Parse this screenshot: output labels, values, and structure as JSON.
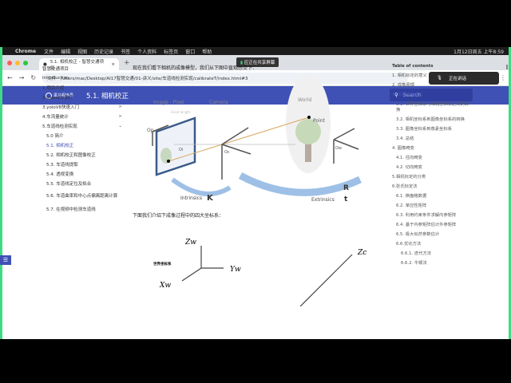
{
  "menubar": {
    "apple": "",
    "app": "Chrome",
    "items": [
      "文件",
      "编辑",
      "视图",
      "历史记录",
      "书签",
      "个人资料",
      "标签页",
      "窗口",
      "帮助"
    ],
    "clock": "1月12日周五 上午8:59"
  },
  "tab": {
    "title": "5.1. 相机校正 - 智慧交通项目",
    "close": "×",
    "new": "+"
  },
  "sharing": "应正在共享屏幕",
  "address": {
    "scheme": "文件",
    "url": "/Users/mac/Desktop/AI17智慧交通/01-讲义/site/车道线检测实现/calibrateT/index.html#3"
  },
  "mic_popup": "正在讲话",
  "header": {
    "logo": "黑马程序员",
    "title": "5.1. 相机校正",
    "search_placeholder": "Search"
  },
  "nav": [
    {
      "label": "智慧交通项目"
    },
    {
      "label": "Introduction"
    },
    {
      "label": "1.项目介绍"
    },
    {
      "label": "2.OpenCV简介",
      "chev": ">"
    },
    {
      "label": "3.yoloV8快速入门",
      "chev": ">"
    },
    {
      "label": "4.车流量统计",
      "chev": ">"
    },
    {
      "label": "5.车道线检测实现",
      "chev": "⌄"
    }
  ],
  "subnav": [
    "5.0 简介",
    "5.1. 相机校正",
    "5.2. 相机校正和图像校正",
    "5.3. 车道线提取",
    "5.4. 透视变换",
    "5.5. 车道线定位及拟合",
    "5.6. 车道曲率和中心点偏离距离计算",
    "5.7. 在视频中检测车道线"
  ],
  "main": {
    "p1": "现在我们看下相机的成像模型，我们从下图中直观感受下：",
    "p2": "下面我们介绍下成像过程中的四大坐标系：",
    "fig1": {
      "image_pixel": "Image - Pixel",
      "camera": "Camera",
      "world": "World",
      "focal": "Focal length",
      "point": "Point",
      "op": "Op",
      "oi": "Oi",
      "oc": "Oc",
      "ow": "Ow",
      "intrinsics": "Intrinsics",
      "K": "K",
      "extrinsics": "Extrinsics",
      "R": "R",
      "t": "t"
    },
    "fig2": {
      "world_cs": "世界坐标系",
      "zw": "Zw",
      "yw": "Yw",
      "xw": "Xw",
      "zc": "Zc"
    }
  },
  "toc": {
    "title": "Table of contents",
    "items": [
      {
        "l": "1. 相机标定的意义",
        "lv": 0
      },
      {
        "l": "2. 成像原理",
        "lv": 0
      },
      {
        "l": "3. 相机成像模型",
        "lv": 0,
        "active": true
      },
      {
        "l": "3.1. 世界坐标系与相机坐标系之间的转换",
        "lv": 1
      },
      {
        "l": "3.2. 相机坐标系到图像坐标系的转换",
        "lv": 1
      },
      {
        "l": "3.3. 图像坐标系到像素坐标系",
        "lv": 1
      },
      {
        "l": "3.4. 总结",
        "lv": 1
      },
      {
        "l": "4. 图像畸变",
        "lv": 0
      },
      {
        "l": "4.1. 径向畸变",
        "lv": 1
      },
      {
        "l": "4.2. 切向畸变",
        "lv": 1
      },
      {
        "l": "5.相机标定的分类",
        "lv": 0
      },
      {
        "l": "6.张氏标定法",
        "lv": 0
      },
      {
        "l": "6.1. 棋盘格数据",
        "lv": 1
      },
      {
        "l": "6.2. 单应性矩阵",
        "lv": 1
      },
      {
        "l": "6.3. 利用约束条件求解内参矩阵",
        "lv": 1
      },
      {
        "l": "6.4. 基于内参矩阵估计外参矩阵",
        "lv": 1
      },
      {
        "l": "6.5. 极大似然参数估计",
        "lv": 1
      },
      {
        "l": "6.6.优化方法",
        "lv": 1
      },
      {
        "l": "6.6.1. 迭代方法",
        "lv": 2
      },
      {
        "l": "6.6.2. 牛顿法",
        "lv": 2
      }
    ]
  }
}
